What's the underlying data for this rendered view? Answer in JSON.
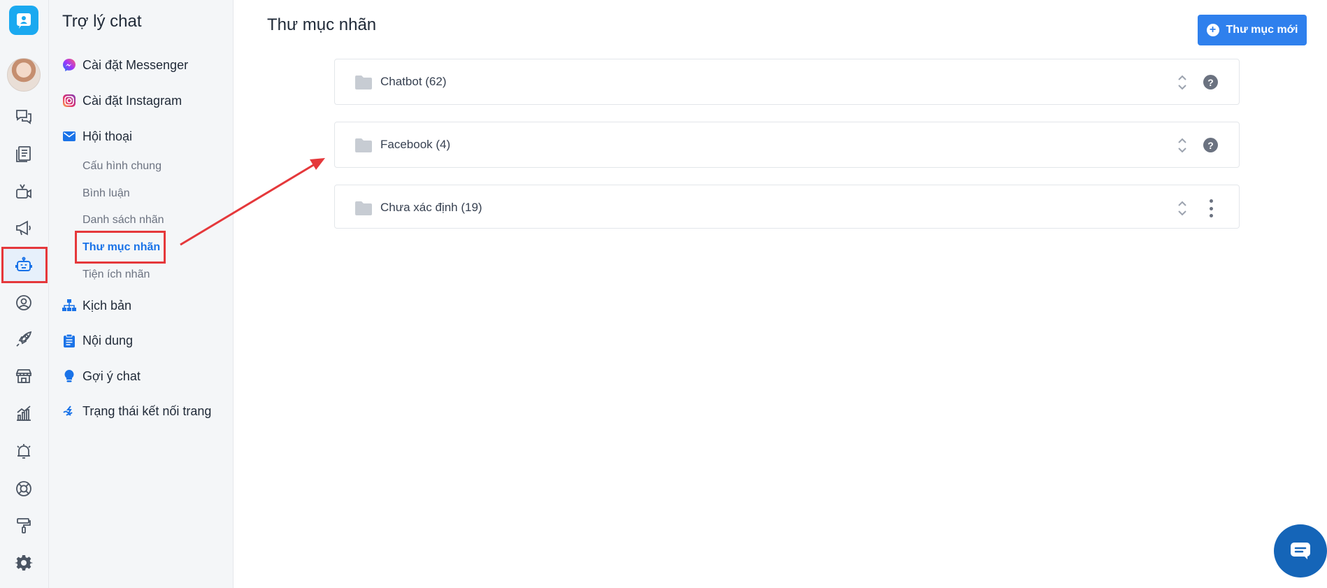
{
  "sidebar": {
    "title": "Trợ lý chat",
    "items": [
      {
        "label": "Cài đặt Messenger",
        "icon": "messenger-icon"
      },
      {
        "label": "Cài đặt Instagram",
        "icon": "instagram-icon"
      },
      {
        "label": "Hội thoại",
        "icon": "mail-icon"
      },
      {
        "label": "Kịch bản",
        "icon": "sitemap-icon"
      },
      {
        "label": "Nội dung",
        "icon": "clipboard-icon"
      },
      {
        "label": "Gợi ý chat",
        "icon": "lightbulb-icon"
      },
      {
        "label": "Trạng thái kết nối trang",
        "icon": "connection-icon"
      }
    ],
    "subitems": [
      {
        "label": "Cấu hình chung"
      },
      {
        "label": "Bình luận"
      },
      {
        "label": "Danh sách nhãn"
      },
      {
        "label": "Thư mục nhãn",
        "active": true
      },
      {
        "label": "Tiện ích nhãn"
      }
    ]
  },
  "rail": {
    "icons": [
      "chat-assistant-logo-icon",
      "avatar",
      "chat-bubbles-icon",
      "document-list-icon",
      "live-video-icon",
      "megaphone-icon",
      "robot-icon",
      "user-circle-icon",
      "rocket-icon",
      "store-icon",
      "chart-icon",
      "alarm-icon",
      "lifebuoy-icon",
      "paint-roller-icon",
      "gear-icon"
    ],
    "active": "robot-icon"
  },
  "main": {
    "title": "Thư mục nhãn",
    "new_button_label": "Thư mục mới",
    "folders": [
      {
        "name": "Chatbot (62)",
        "action": "help-icon"
      },
      {
        "name": "Facebook (4)",
        "action": "help-icon"
      },
      {
        "name": "Chưa xác định (19)",
        "action": "more-icon"
      }
    ]
  },
  "colors": {
    "accent": "#2f80ed",
    "active_link": "#1a73e8",
    "highlight_border": "#e5383b",
    "sidebar_bg": "#f4f6f8"
  }
}
